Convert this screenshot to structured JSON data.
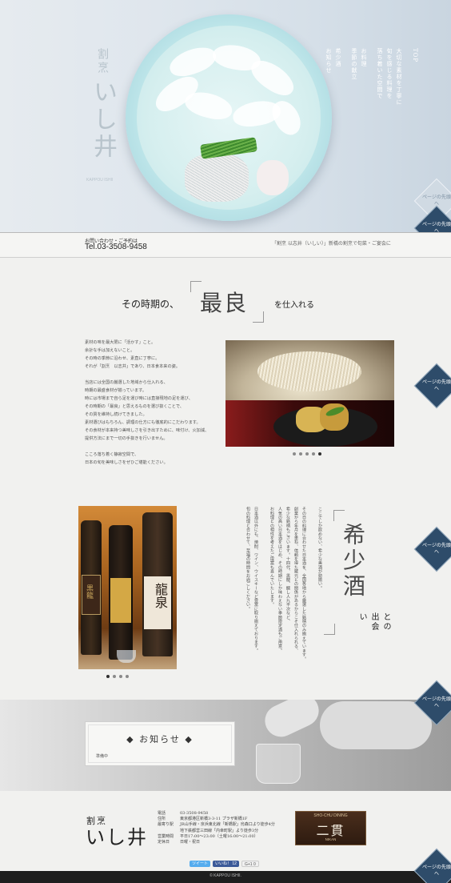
{
  "hero": {
    "logo_sub": "割烹",
    "logo_main": "いし井",
    "logo_en": "KAPPOU ISHII",
    "menu": [
      [
        "TOP"
      ],
      [
        "大切な素材を丁寧に",
        "旬を感じる料理を",
        "落ち着いた空間で"
      ],
      [
        "お料理",
        "季節の献立"
      ],
      [
        "希少酒",
        "お知らせ"
      ]
    ]
  },
  "contact": {
    "label": "お問い合わせ・ご予約は",
    "tel": "Tel.03-3508-9458",
    "right_text": "「割烹 以志井（いしい）」新橋の割烹で旬菜・ご宴会に"
  },
  "section_best": {
    "pre": "その時期の、",
    "big": "最良",
    "post": "を仕入れる",
    "text": "素材の味を最大限に「活かす」こと。\n余計な手は加えないこと。\nその時の季節に沿わせ、素直に丁寧に。\nそれが「割烹　以志井」であり、日本食本来の姿。\n\n当店には全国の厳選した地域から仕入れる、\n時期の最盛食材が揃っています。\n時には市場まで自ら足を運び時には直接現地の足を運び、\nその時期の「最良」と思えるものを選び抜くことで、\nその質を維持し続けてきました。\n素材選びはもちろん、調理の仕方にも徹底的にこだわります。\nその食材が本来持つ美味しさを引き出すために、味付け、火加減、\n提供方法にまで一切の手抜きを行いません。\n\nこころ落ち着く静寂空間で、\n日本の旬を美味しさをぜひご堪能ください。",
    "dots": 5,
    "active_dot": 4
  },
  "section_sake": {
    "title_big": "希少酒",
    "title_post": "との出会い",
    "text": "ここでしか飲めない、希少な美酒が勢揃い。\n\nその日の料理に合わせた日本酒を、全国各地から厳選した銘柄のみ揃えています。\n創業から年月を重ね、信頼を得た蔵元との関係があるからこそ仕入れられる、\n希少な銘柄もございます。十四代、黒龍、醸し人九平次など、\n人気の高い日本酒をはじめ、その時期にしか味わえない季節限定酒もご用意。\nお料理との相性を考えたご提案も喜んでいたします。\n\n日本酒以外にも、焼酎、ワイン、ウイスキーなど豊富に取り揃えております。\n旬の料理と合わせて、至福の時間をお過ごしください。",
    "label_left": "黒龍",
    "label_right": "龍泉",
    "dots": 4,
    "active_dot": 0
  },
  "news": {
    "title": "お知らせ",
    "body": "準備中"
  },
  "footer": {
    "logo_sub": "割烹",
    "logo_main": "いし井",
    "info": [
      {
        "k": "電話",
        "v": "03-3508-9458"
      },
      {
        "k": "住所",
        "v": "東京都港区新橋3-3-11 プラザ新橋1F"
      },
      {
        "k": "最寄り駅",
        "v": "JR山手線・京浜東北線「新橋駅」烏森口より徒歩4分"
      },
      {
        "k": "",
        "v": "地下鉄都営三田線「内幸町駅」より徒歩3分"
      },
      {
        "k": "営業時間",
        "v": "平日17:00〜23:00（土曜16:00〜21:00）"
      },
      {
        "k": "定休日",
        "v": "日曜・祝日"
      }
    ],
    "banner_top": "SHO-CHU DINING",
    "banner_main": "二貫",
    "banner_en": "NIKAN",
    "social": [
      "ツイート",
      "いいね！ 12",
      "G+1 0"
    ],
    "copyright": "© KAPPOU ISHII."
  },
  "nav": {
    "page_top": "ページの先頭へ"
  },
  "colors": {
    "accent_navy": "#2e4c6a",
    "twitter": "#55acee",
    "facebook": "#3b5998",
    "gplus": "#dd4b39"
  }
}
